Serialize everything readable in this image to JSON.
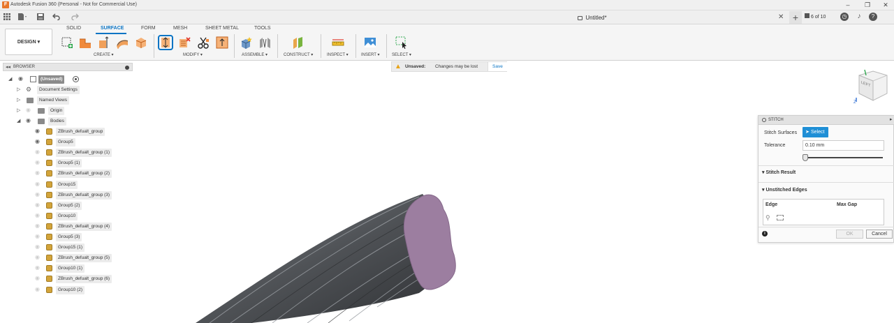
{
  "window": {
    "title": "Autodesk Fusion 360 (Personal - Not for Commercial Use)",
    "app_icon_letter": "F",
    "controls": [
      "–",
      "❐",
      "✕"
    ]
  },
  "tabbar": {
    "document_title": "Untitled*",
    "close_glyph": "✕",
    "new_tab_glyph": "+",
    "job_status": "6 of 10"
  },
  "ribbon": {
    "workspace": "DESIGN ▾",
    "tabs": [
      "SOLID",
      "SURFACE",
      "FORM",
      "MESH",
      "SHEET METAL",
      "TOOLS"
    ],
    "active_tab": "SURFACE",
    "groups": [
      "CREATE ▾",
      "MODIFY ▾",
      "ASSEMBLE ▾",
      "CONSTRUCT ▾",
      "INSPECT ▾",
      "INSERT ▾",
      "SELECT ▾"
    ]
  },
  "browser": {
    "title": "BROWSER",
    "root": "(Unsaved)",
    "nodes": {
      "document_settings": "Document Settings",
      "named_views": "Named Views",
      "origin": "Origin",
      "bodies": "Bodies"
    },
    "bodies": [
      {
        "label": "ZBrush_defualt_group",
        "visible": true
      },
      {
        "label": "Group5",
        "visible": true
      },
      {
        "label": "ZBrush_defualt_group (1)",
        "visible": false
      },
      {
        "label": "Group5 (1)",
        "visible": false
      },
      {
        "label": "ZBrush_defualt_group (2)",
        "visible": false
      },
      {
        "label": "Group15",
        "visible": false
      },
      {
        "label": "ZBrush_defualt_group (3)",
        "visible": false
      },
      {
        "label": "Group5 (2)",
        "visible": false
      },
      {
        "label": "Group10",
        "visible": false
      },
      {
        "label": "ZBrush_defualt_group (4)",
        "visible": false
      },
      {
        "label": "Group5 (3)",
        "visible": false
      },
      {
        "label": "Group15 (1)",
        "visible": false
      },
      {
        "label": "ZBrush_defualt_group (5)",
        "visible": false
      },
      {
        "label": "Group10 (1)",
        "visible": false
      },
      {
        "label": "ZBrush_defualt_group (6)",
        "visible": false
      },
      {
        "label": "Group10 (2)",
        "visible": false
      }
    ]
  },
  "banner": {
    "label": "Unsaved:",
    "message": "Changes may be lost",
    "action": "Save"
  },
  "viewcube": {
    "face": "LEFT",
    "axis": "Z"
  },
  "stitch": {
    "title": "STITCH",
    "surfaces_label": "Stitch Surfaces",
    "select_label": "Select",
    "tolerance_label": "Tolerance",
    "tolerance_value": "0.10 mm",
    "tolerance_slider_fraction": 0.0,
    "section_result": "Stitch Result",
    "section_unstitched": "Unstitched Edges",
    "col_edge": "Edge",
    "col_gap": "Max Gap",
    "ok": "OK",
    "cancel": "Cancel"
  },
  "colors": {
    "accent": "#0a74c4",
    "select_button": "#1f8fd6",
    "body_icon": "#d3a43a",
    "model_surface": "#5c5f63",
    "model_cap": "#9c7ea0"
  }
}
